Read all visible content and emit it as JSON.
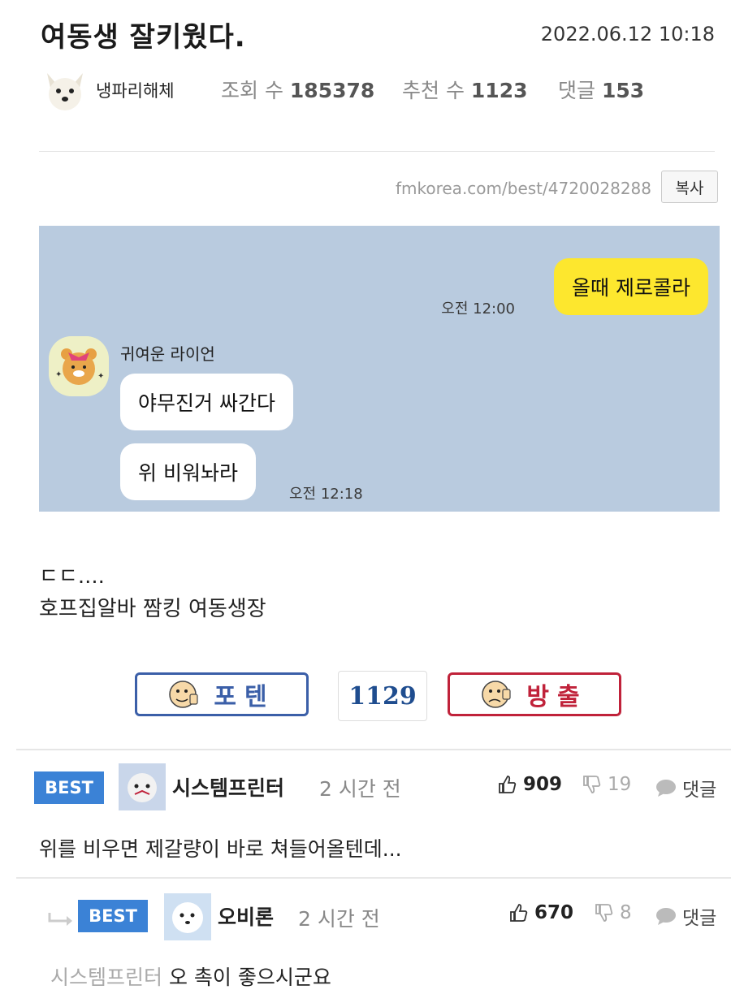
{
  "post": {
    "title": "여동생 잘키웠다.",
    "date": "2022.06.12 10:18",
    "author": "냉파리해체",
    "views_label": "조회 수",
    "views": "185378",
    "recommends_label": "추천 수",
    "recommends": "1123",
    "comments_label": "댓글",
    "comments": "153",
    "url": "fmkorea.com/best/4720028288",
    "copy_label": "복사",
    "body_lines": [
      "ㄷㄷ....",
      "호프집알바 짬킹 여동생장"
    ]
  },
  "chat": {
    "sent_message": "올때 제로콜라",
    "sent_time": "오전 12:00",
    "contact_name": "귀여운 라이언",
    "received": [
      "야무진거 싸간다",
      "위 비워놔라"
    ],
    "received_time": "오전 12:18"
  },
  "votes": {
    "up_label": "포텐",
    "count": "1129",
    "down_label": "방출"
  },
  "comments": [
    {
      "badge": "BEST",
      "author": "시스템프린터",
      "time": "2 시간 전",
      "likes": "909",
      "dislikes": "19",
      "reply_label": "댓글",
      "text": "위를 비우면 제갈량이 바로 쳐들어올텐데..."
    },
    {
      "badge": "BEST",
      "author": "오비론",
      "time": "2 시간 전",
      "likes": "670",
      "dislikes": "8",
      "reply_label": "댓글",
      "reply_to": "시스템프린터",
      "text": "오 촉이 좋으시군요"
    }
  ],
  "colors": {
    "chat_bg": "#b9cbdf",
    "sent_bubble": "#fde72e",
    "best_badge": "#3b82d6",
    "vote_up": "#3b5fa8",
    "vote_down": "#c0223a"
  }
}
